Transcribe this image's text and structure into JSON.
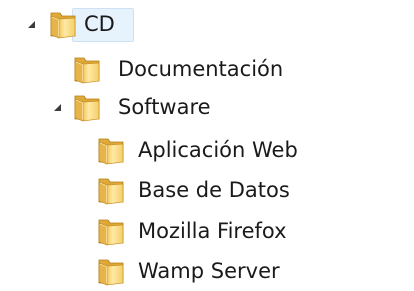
{
  "tree": {
    "root": {
      "label": "CD",
      "expanded": true,
      "selected": true
    },
    "items": [
      {
        "label": "Documentación",
        "expanded": null
      },
      {
        "label": "Software",
        "expanded": true
      },
      {
        "label": "Aplicación Web",
        "expanded": null
      },
      {
        "label": "Base de Datos",
        "expanded": null
      },
      {
        "label": "Mozilla Firefox",
        "expanded": null
      },
      {
        "label": "Wamp Server",
        "expanded": null
      }
    ]
  },
  "icons": {
    "folder": "folder-icon",
    "expanded": "expanded-triangle-icon"
  },
  "colors": {
    "folder_light": "#f7df8b",
    "folder_dark": "#d9a93a",
    "selection": "#e6f2fc",
    "expander": "#3c3c3c"
  }
}
